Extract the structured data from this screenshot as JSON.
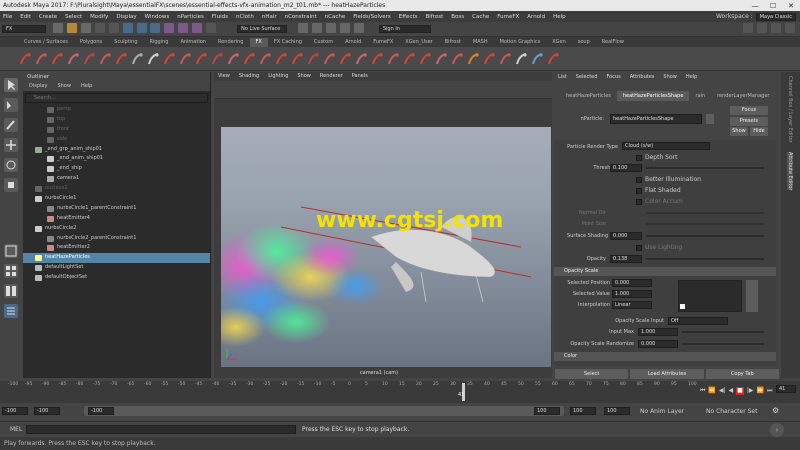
{
  "window": {
    "title": "Autodesk Maya 2017: F:\\Pluralsight\\Maya\\essentialFX\\scenes\\essential-effects-vfx-animation_m2_t01.mb*  ---  heatHazeParticles",
    "min": "—",
    "max": "☐",
    "close": "✕"
  },
  "menubar": {
    "items": [
      "File",
      "Edit",
      "Create",
      "Select",
      "Modify",
      "Display",
      "Windows",
      "nParticles",
      "Fluids",
      "nCloth",
      "nHair",
      "nConstraint",
      "nCache",
      "Fields/Solvers",
      "Effects",
      "Bifrost",
      "Boss",
      "Cache",
      "FumeFX",
      "Arnold",
      "Help"
    ],
    "workspace_label": "Workspace :",
    "workspace_value": "Maya Classic"
  },
  "statusline": {
    "mode": "FX",
    "live_surface": "No Live Surface",
    "sign_in": "Sign In"
  },
  "shelf": {
    "tabs": [
      "Curves / Surfaces",
      "Polygons",
      "Sculpting",
      "Rigging",
      "Animation",
      "Rendering",
      "FX",
      "FX Caching",
      "Custom",
      "Arnold",
      "FumeFX",
      "XGen_User",
      "Bifrost",
      "MASH",
      "Motion Graphics",
      "XGen",
      "soup",
      "RealFlow"
    ],
    "active_tab": "FX"
  },
  "outliner": {
    "title": "Outliner",
    "menu": [
      "Display",
      "Show",
      "Help"
    ],
    "search_placeholder": "Search...",
    "items": [
      {
        "label": "persp",
        "indent": 1,
        "dim": true
      },
      {
        "label": "top",
        "indent": 1,
        "dim": true
      },
      {
        "label": "front",
        "indent": 1,
        "dim": true
      },
      {
        "label": "side",
        "indent": 1,
        "dim": true
      },
      {
        "label": "_end_grp_anim_ship01",
        "indent": 0,
        "dim": false
      },
      {
        "label": "_end_anim_ship01",
        "indent": 1,
        "dim": false
      },
      {
        "label": "_end_ship",
        "indent": 1,
        "dim": false
      },
      {
        "label": "camera1",
        "indent": 1,
        "dim": false
      },
      {
        "label": "nucleus1",
        "indent": 0,
        "dim": true
      },
      {
        "label": "nurbsCircle1",
        "indent": 0,
        "dim": false
      },
      {
        "label": "nurbsCircle1_parentConstraint1",
        "indent": 1,
        "dim": false
      },
      {
        "label": "heatEmitter4",
        "indent": 1,
        "dim": false
      },
      {
        "label": "nurbsCircle2",
        "indent": 0,
        "dim": false
      },
      {
        "label": "nurbsCircle2_parentConstraint1",
        "indent": 1,
        "dim": false
      },
      {
        "label": "heatEmitter2",
        "indent": 1,
        "dim": false
      },
      {
        "label": "heatHazeParticles",
        "indent": 0,
        "dim": false,
        "selected": true
      },
      {
        "label": "defaultLightSet",
        "indent": 0,
        "dim": false
      },
      {
        "label": "defaultObjectSet",
        "indent": 0,
        "dim": false
      }
    ]
  },
  "viewport": {
    "menu": [
      "View",
      "Shading",
      "Lighting",
      "Show",
      "Renderer",
      "Panels"
    ],
    "watermark": "www.cgtsj.com",
    "camera_label": "camera1 (cam)"
  },
  "attr": {
    "menu": [
      "List",
      "Selected",
      "Focus",
      "Attributes",
      "Show",
      "Help"
    ],
    "tabs": [
      "heatHazeParticles",
      "heatHazeParticlesShape",
      "rain",
      "renderLayerManager"
    ],
    "active_tab": "heatHazeParticlesShape",
    "node_label": "nParticle:",
    "node_value": "heatHazeParticlesShape",
    "focus": "Focus",
    "presets": "Presets",
    "show": "Show",
    "hide": "Hide",
    "render_type_label": "Particle Render Type",
    "render_type_value": "Cloud (s/w)",
    "depth_sort": "Depth Sort",
    "threshold_label": "Threshold",
    "threshold_value": "0.100",
    "better_illum": "Better Illumination",
    "flat_shaded": "Flat Shaded",
    "color_accum": "Color Accum",
    "normal_dir_label": "Normal Dir",
    "point_size_label": "Point Size",
    "surface_shading_label": "Surface Shading",
    "surface_shading_value": "0.000",
    "use_lighting": "Use Lighting",
    "opacity_label": "Opacity",
    "opacity_value": "0.138",
    "opacity_scale_title": "Opacity Scale",
    "selected_position_label": "Selected Position",
    "selected_position_value": "0.000",
    "selected_value_label": "Selected Value",
    "selected_value_value": "1.000",
    "interpolation_label": "Interpolation",
    "interpolation_value": "Linear",
    "opacity_scale_input_label": "Opacity Scale Input",
    "opacity_scale_input_value": "Off",
    "input_max_label": "Input Max",
    "input_max_value": "1.000",
    "opacity_randomize_label": "Opacity Scale Randomize",
    "opacity_randomize_value": "0.000",
    "color_title": "Color",
    "select_btn": "Select",
    "load_btn": "Load Attributes",
    "copy_btn": "Copy Tab"
  },
  "sidetabs": [
    "Channel Box / Layer Editor",
    "Attribute Editor"
  ],
  "timeslider": {
    "ticks": [
      "-100",
      "-95",
      "-90",
      "-85",
      "-80",
      "-75",
      "-70",
      "-65",
      "-60",
      "-55",
      "-50",
      "-45",
      "-40",
      "-35",
      "-30",
      "-25",
      "-20",
      "-15",
      "-10",
      "-5",
      "0",
      "5",
      "10",
      "15",
      "20",
      "25",
      "30",
      "35",
      "40",
      "45",
      "50",
      "55",
      "60",
      "65",
      "70",
      "75",
      "80",
      "85",
      "90",
      "95",
      "100"
    ],
    "current_frame": "41",
    "frame_field": "41"
  },
  "rangeslider": {
    "start": "-100",
    "start2": "-100",
    "range_start": "-100",
    "range_end": "100",
    "end": "100",
    "end2": "100",
    "anim_layer": "No Anim Layer",
    "char_set": "No Character Set"
  },
  "cmdline": {
    "lang": "MEL",
    "message": "Press the ESC key to stop playback."
  },
  "helpline": {
    "text": "Play forwards. Press the ESC key to stop playback."
  }
}
